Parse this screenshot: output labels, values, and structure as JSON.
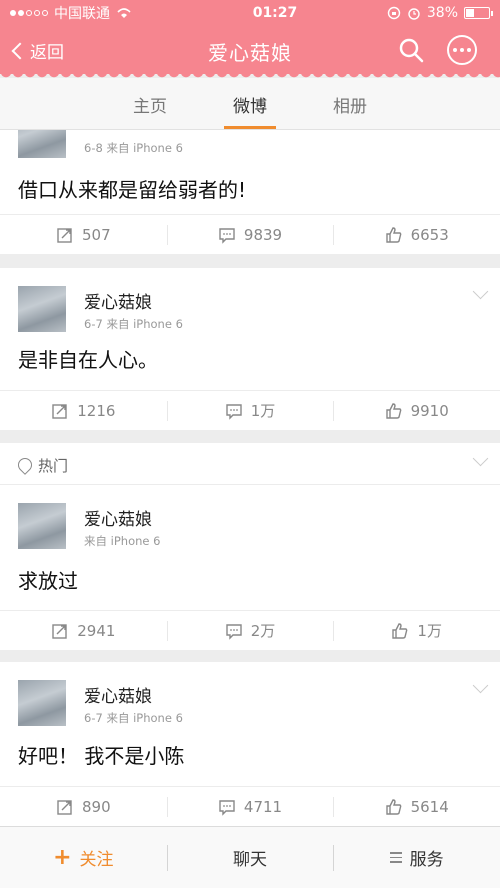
{
  "status_bar": {
    "carrier": "中国联通",
    "time": "01:27",
    "battery": "38%",
    "battery_level": 0.38
  },
  "nav": {
    "back_label": "返回",
    "title": "爱心菇娘"
  },
  "tabs": [
    {
      "label": "主页"
    },
    {
      "label": "微博"
    },
    {
      "label": "相册"
    }
  ],
  "posts": [
    {
      "meta": "6-8  来自 iPhone 6",
      "text": "借口从来都是留给弱者的!",
      "reposts": "507",
      "comments": "9839",
      "likes": "6653"
    },
    {
      "username": "爱心菇娘",
      "meta": "6-7  来自 iPhone 6",
      "text": "是非自在人心。",
      "reposts": "1216",
      "comments": "1万",
      "likes": "9910"
    },
    {
      "username": "爱心菇娘",
      "meta": "来自 iPhone 6",
      "text": "求放过",
      "reposts": "2941",
      "comments": "2万",
      "likes": "1万"
    },
    {
      "username": "爱心菇娘",
      "meta": "6-7  来自 iPhone 6",
      "text": "好吧！ 我不是小陈",
      "reposts": "890",
      "comments": "4711",
      "likes": "5614"
    }
  ],
  "hot_label": "热门",
  "bottom_bar": {
    "follow": "关注",
    "chat": "聊天",
    "service": "服务"
  },
  "colors": {
    "brand_pink": "#f6858f",
    "accent_orange": "#f08c2e"
  },
  "icons": [
    "wifi-icon",
    "alarm-icon",
    "search-icon",
    "more-icon",
    "repost-icon",
    "comment-icon",
    "like-icon",
    "location-pin-icon",
    "menu-icon"
  ]
}
